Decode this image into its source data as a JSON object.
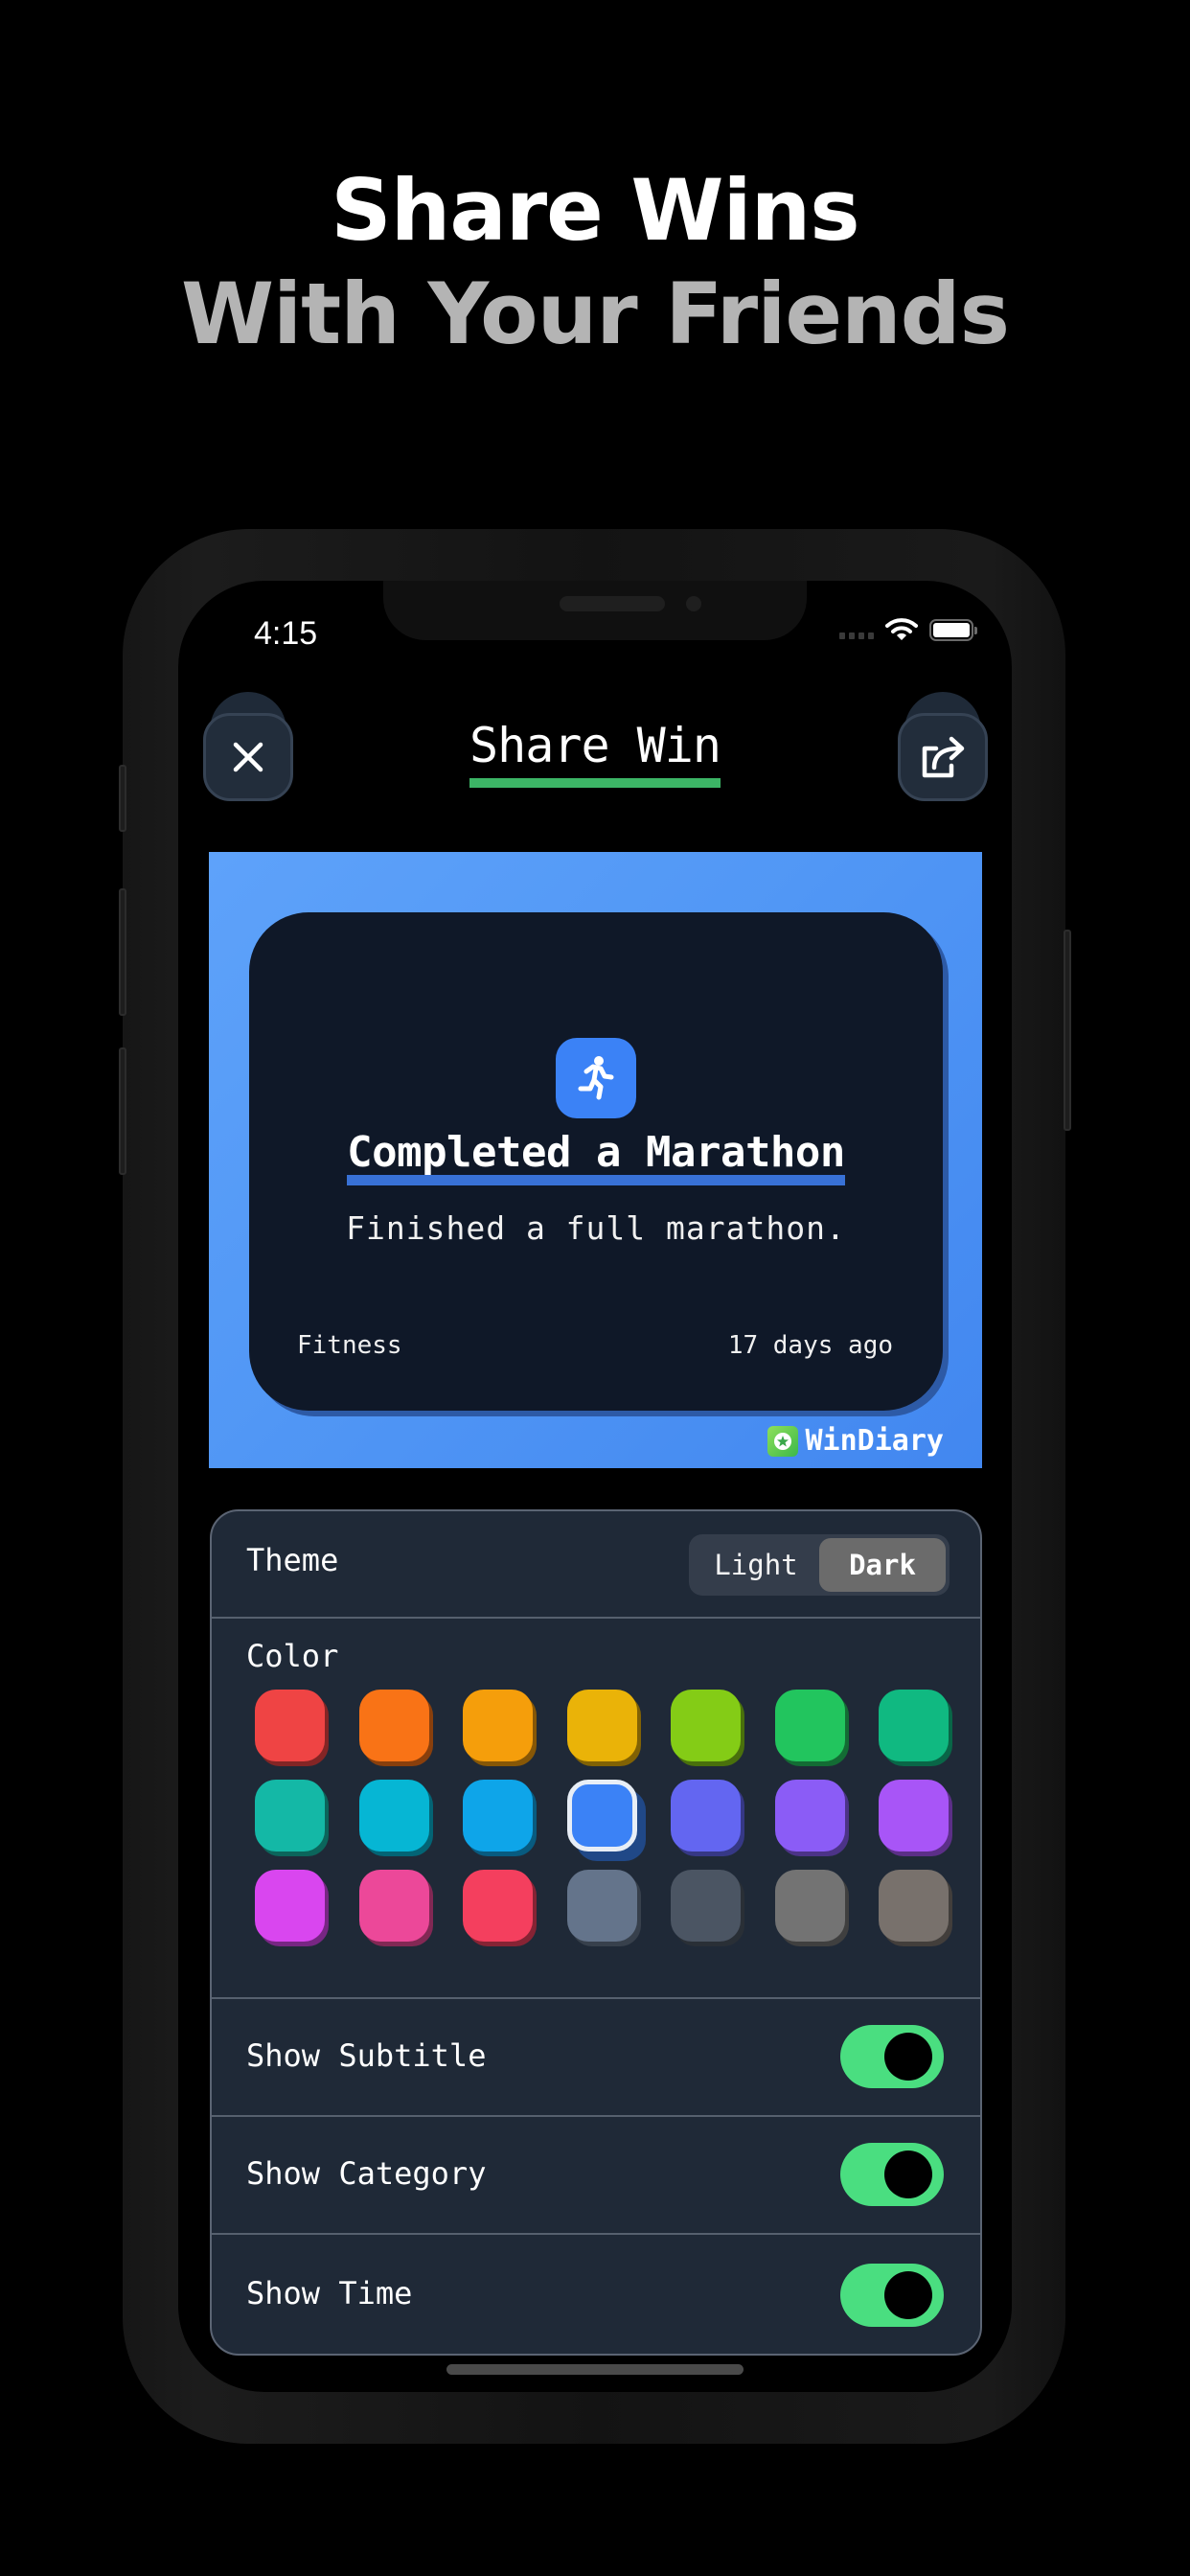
{
  "headline": {
    "line1": "Share Wins",
    "line2": "With Your Friends"
  },
  "status_bar": {
    "time": "4:15",
    "icons": [
      "signal-dots-icon",
      "wifi-icon",
      "battery-icon"
    ]
  },
  "header": {
    "title": "Share Win",
    "close_icon": "close-icon",
    "share_icon": "share-icon",
    "title_underline_color": "#3cb566"
  },
  "preview": {
    "background_color": "#3b82f6",
    "card": {
      "icon": "running-person-icon",
      "title": "Completed a Marathon",
      "subtitle": "Finished a full marathon.",
      "category": "Fitness",
      "time_ago": "17 days ago"
    },
    "brand": {
      "logo_icon": "windiary-logo-icon",
      "name": "WinDiary"
    }
  },
  "settings": {
    "theme": {
      "label": "Theme",
      "options": [
        "Light",
        "Dark"
      ],
      "selected": "Dark"
    },
    "color": {
      "label": "Color",
      "selected_index": 10,
      "swatches": [
        {
          "name": "red",
          "hex": "#ef4444"
        },
        {
          "name": "orange",
          "hex": "#f97316"
        },
        {
          "name": "amber",
          "hex": "#f59e0b"
        },
        {
          "name": "yellow",
          "hex": "#eab308"
        },
        {
          "name": "lime",
          "hex": "#84cc16"
        },
        {
          "name": "green",
          "hex": "#22c55e"
        },
        {
          "name": "emerald",
          "hex": "#10b981"
        },
        {
          "name": "teal",
          "hex": "#14b8a6"
        },
        {
          "name": "cyan",
          "hex": "#06b6d4"
        },
        {
          "name": "sky",
          "hex": "#0ea5e9"
        },
        {
          "name": "blue",
          "hex": "#3b82f6"
        },
        {
          "name": "indigo",
          "hex": "#6366f1"
        },
        {
          "name": "violet",
          "hex": "#8b5cf6"
        },
        {
          "name": "purple",
          "hex": "#a855f7"
        },
        {
          "name": "fuchsia",
          "hex": "#d946ef"
        },
        {
          "name": "pink",
          "hex": "#ec4899"
        },
        {
          "name": "rose",
          "hex": "#f43f5e"
        },
        {
          "name": "slate",
          "hex": "#64748b"
        },
        {
          "name": "gray",
          "hex": "#4b5563"
        },
        {
          "name": "neutral",
          "hex": "#737373"
        },
        {
          "name": "stone",
          "hex": "#78716c"
        }
      ]
    },
    "toggles": [
      {
        "label": "Show Subtitle",
        "on": true
      },
      {
        "label": "Show Category",
        "on": true
      },
      {
        "label": "Show Time",
        "on": true
      }
    ],
    "toggle_on_color": "#4ade80"
  }
}
